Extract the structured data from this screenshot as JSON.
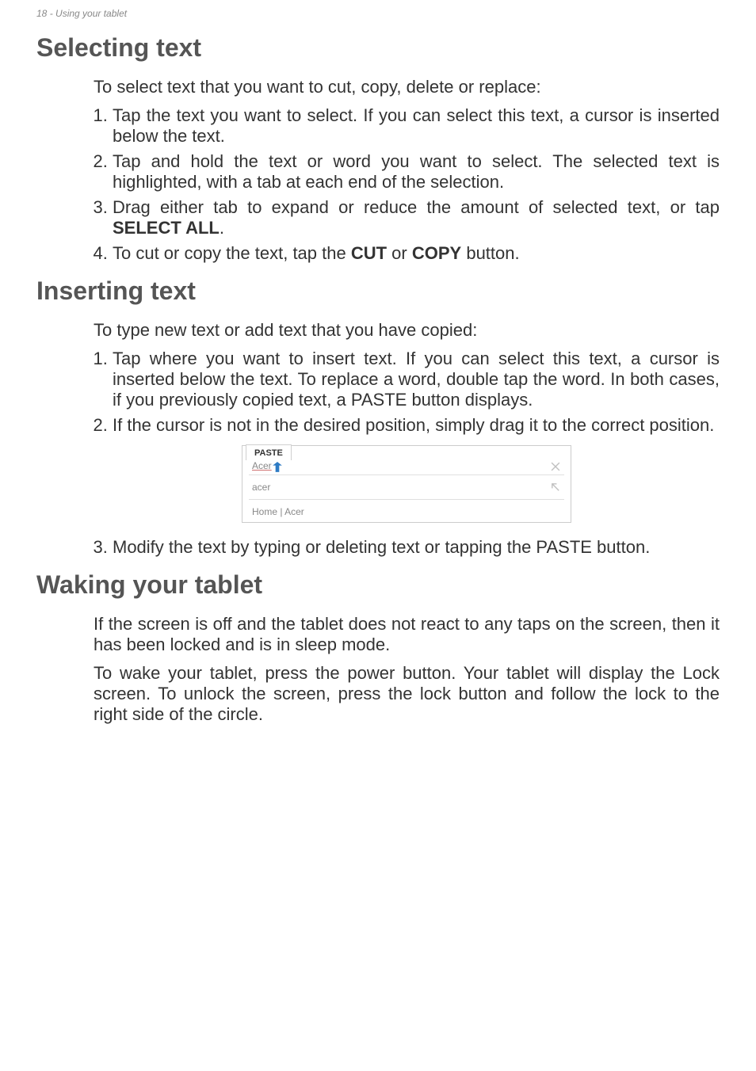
{
  "header": {
    "page_number": "18",
    "section_ref": "Using your tablet"
  },
  "sections": {
    "selecting": {
      "heading": "Selecting text",
      "intro": "To select text that you want to cut, copy, delete or replace:",
      "steps": {
        "s1": "Tap the text you want to select. If you can select this text, a cursor is inserted below the text.",
        "s2": "Tap and hold the text or word you want to select. The selected text is highlighted, with a tab at each end of the selection.",
        "s3_pre": "Drag either tab to expand or reduce the amount of selected text, or tap ",
        "s3_bold": "SELECT ALL",
        "s3_post": ".",
        "s4_pre": "To cut or copy the text, tap the ",
        "s4_bold1": "CUT",
        "s4_mid": " or ",
        "s4_bold2": "COPY",
        "s4_post": " button."
      }
    },
    "inserting": {
      "heading": "Inserting text",
      "intro": "To type new text or add text that you have copied:",
      "steps": {
        "s1": "Tap where you want to insert text. If you can select this text, a cursor is inserted below the text. To replace a word, double tap the word. In both cases, if you previously copied text, a PASTE button displays.",
        "s2": "If the cursor is not in the desired position, simply drag it to the correct position.",
        "s3": "Modify the text by typing or deleting text or tapping the PASTE button."
      }
    },
    "figure": {
      "paste_label": "PASTE",
      "input_text": "Acer",
      "suggest1": "acer",
      "suggest2": "Home | Acer"
    },
    "waking": {
      "heading": "Waking your tablet",
      "p1": "If the screen is off and the tablet does not react to any taps on the screen, then it has been locked and is in sleep mode.",
      "p2": "To wake your tablet, press the power button. Your tablet will display the Lock screen. To unlock the screen, press the lock button and follow the lock to the right side of the circle."
    }
  }
}
